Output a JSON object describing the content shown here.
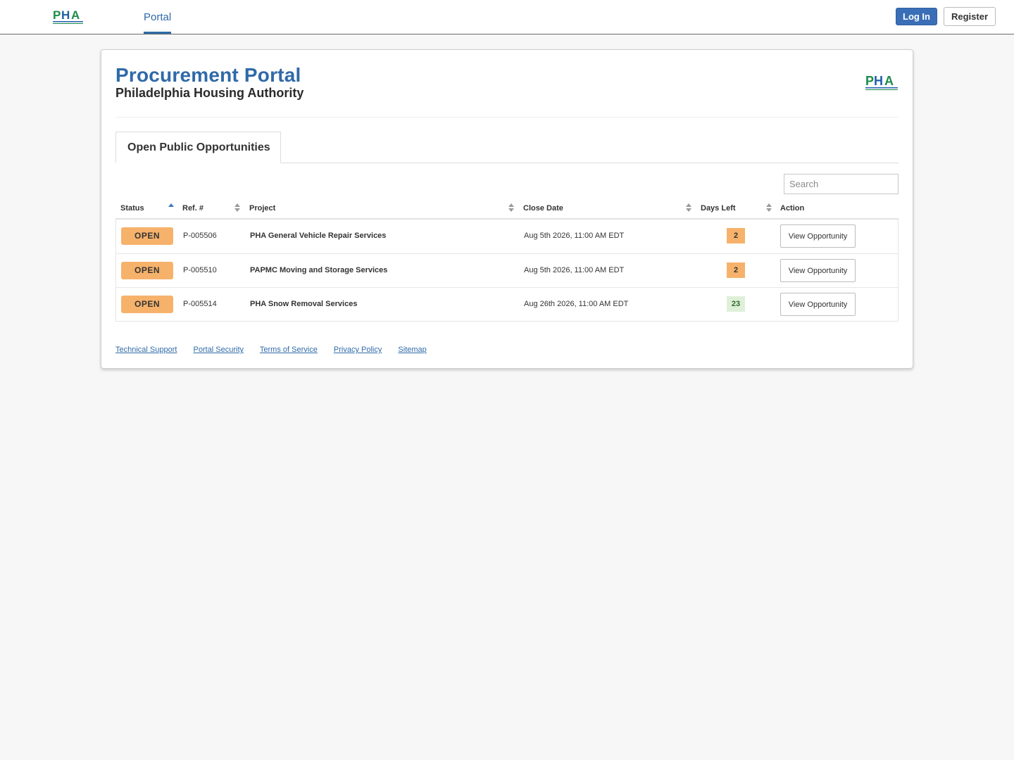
{
  "nav": {
    "logo_text": "PHA",
    "tab_label": "Portal",
    "login_label": "Log In",
    "register_label": "Register"
  },
  "header": {
    "title": "Procurement Portal",
    "subtitle": "Philadelphia Housing Authority",
    "logo_text": "PHA"
  },
  "tabs": [
    {
      "label": "Open Public Opportunities",
      "active": true
    }
  ],
  "search": {
    "placeholder": "Search",
    "value": ""
  },
  "table": {
    "columns": [
      "Status",
      "Ref. #",
      "Project",
      "Close Date",
      "Days Left",
      "Action"
    ],
    "sorted_column": "Status",
    "sort_direction": "ascending",
    "rows": [
      {
        "status": "OPEN",
        "ref": "P-005506",
        "project": "PHA General Vehicle Repair Services",
        "close_date": "Aug 5th 2026, 11:00 AM EDT",
        "days_left": "2",
        "days_state": "warn",
        "action": "View Opportunity"
      },
      {
        "status": "OPEN",
        "ref": "P-005510",
        "project": "PAPMC Moving and Storage Services",
        "close_date": "Aug 5th 2026, 11:00 AM EDT",
        "days_left": "2",
        "days_state": "warn",
        "action": "View Opportunity"
      },
      {
        "status": "OPEN",
        "ref": "P-005514",
        "project": "PHA Snow Removal Services",
        "close_date": "Aug 26th 2026, 11:00 AM EDT",
        "days_left": "23",
        "days_state": "ok",
        "action": "View Opportunity"
      }
    ]
  },
  "footer": {
    "links": [
      "Technical Support",
      "Portal Security",
      "Terms of Service",
      "Privacy Policy",
      "Sitemap"
    ]
  },
  "colors": {
    "accent_blue": "#2f6aa8",
    "status_orange": "#f6b26b",
    "ok_green_bg": "#dff0d8",
    "logo_blue": "#1f5fa8",
    "logo_green": "#1e8a4a"
  },
  "icons": {
    "sort_asc": "sort-ascending-icon",
    "sort_both": "sort-both-icon"
  }
}
